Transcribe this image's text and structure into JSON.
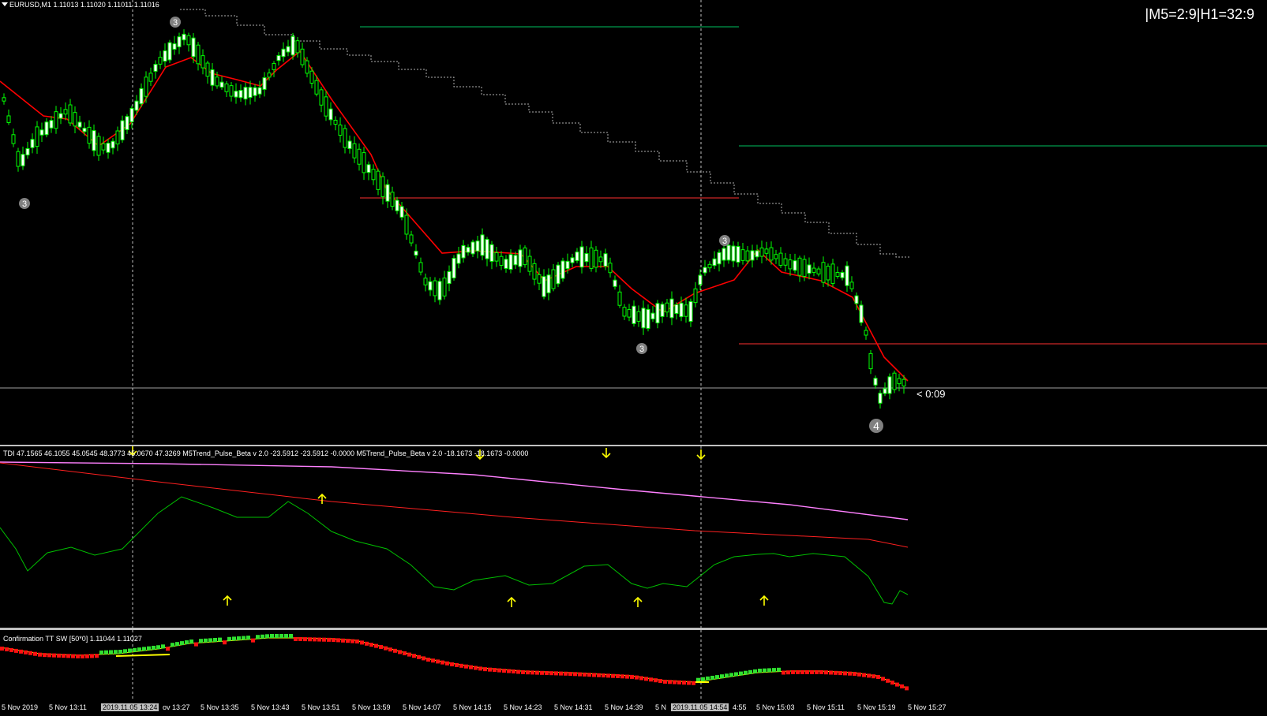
{
  "header": {
    "symbol_info": "EURUSD,M1  1.11013 1.11020 1.11011 1.11016",
    "timeframe_box": "|M5=2:9|H1=32:9",
    "countdown": "< 0:09"
  },
  "wave_labels": [
    "3",
    "3",
    "3",
    "3",
    "4"
  ],
  "tdi": {
    "info": "TDI 47.1565 46.1055 45.0545 48.3773 45.0670 47.3269  M5Trend_Pulse_Beta v 2.0 -23.5912 -23.5912 -0.0000  M5Trend_Pulse_Beta v 2.0 -18.1673 -18.1673 -0.0000"
  },
  "confirmation": {
    "info": "Confirmation TT SW [50*0] 1.11044 1.11027"
  },
  "time_axis": {
    "ticks": [
      "5 Nov 2019",
      "5 Nov 13:11",
      "2019.11.05 13:24",
      "ov 13:27",
      "5 Nov 13:35",
      "5 Nov 13:43",
      "5 Nov 13:51",
      "5 Nov 13:59",
      "5 Nov 14:07",
      "5 Nov 14:15",
      "5 Nov 14:23",
      "5 Nov 14:31",
      "5 Nov 14:39",
      "5 N",
      "2019.11.05 14:54",
      "4:55",
      "5 Nov 15:03",
      "5 Nov 15:11",
      "5 Nov 15:19",
      "5 Nov 15:27"
    ]
  },
  "colors": {
    "bull_candle": "#ffffff",
    "bear_candle": "#00ff00",
    "ma_line": "#ff0000",
    "support_line": "#00c060",
    "resistance_line": "#ff3030",
    "tdi_magenta": "#ff80ff",
    "tdi_red": "#ff2020",
    "tdi_green": "#00c000",
    "arrow": "#ffff00",
    "tt_green": "#30e030",
    "tt_red": "#ff1010",
    "tt_line": "#ffff00"
  }
}
